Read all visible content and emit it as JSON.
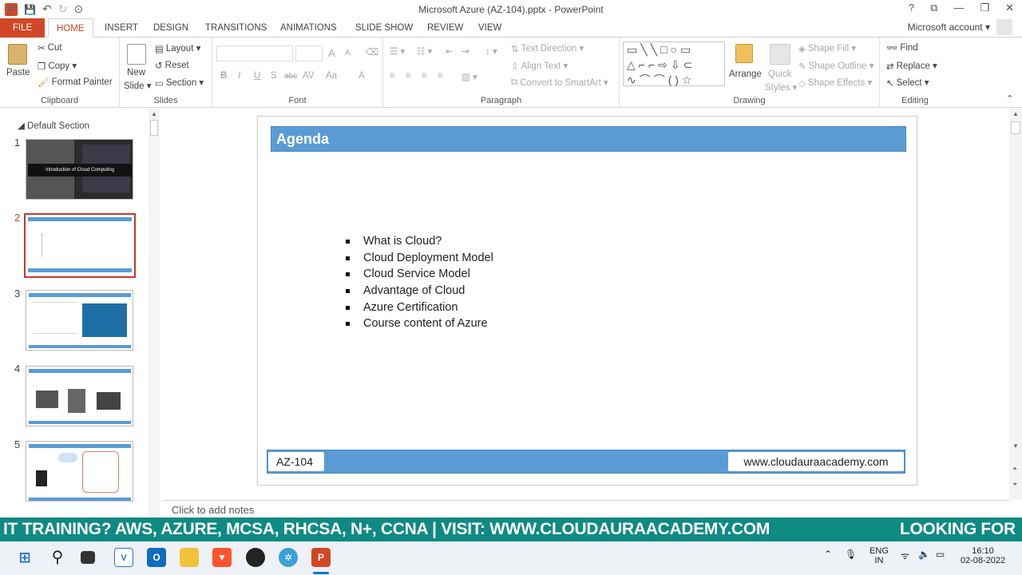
{
  "window": {
    "title": "Microsoft Azure (AZ-104).pptx - PowerPoint",
    "help": "?",
    "ribbon_display": "⧉",
    "minimize": "—",
    "maximize": "❐",
    "close": "✕"
  },
  "qat": {
    "app_icon": "P",
    "save": "💾",
    "undo": "↶",
    "redo": "↻",
    "customize": "⊙"
  },
  "tabs": [
    "FILE",
    "HOME",
    "INSERT",
    "DESIGN",
    "TRANSITIONS",
    "ANIMATIONS",
    "SLIDE SHOW",
    "REVIEW",
    "VIEW"
  ],
  "account": "Microsoft account",
  "ribbon": {
    "clipboard": {
      "label": "Clipboard",
      "paste": "Paste",
      "cut": "Cut",
      "copy": "Copy",
      "format_painter": "Format Painter"
    },
    "slides": {
      "label": "Slides",
      "new_slide": "New",
      "new_slide2": "Slide",
      "layout": "Layout",
      "reset": "Reset",
      "section": "Section"
    },
    "font": {
      "label": "Font",
      "bold": "B",
      "italic": "I",
      "underline": "U",
      "shadow": "S",
      "strike": "abc",
      "spacing": "AV",
      "case": "Aa",
      "grow": "A",
      "shrink": "A",
      "color": "A"
    },
    "paragraph": {
      "label": "Paragraph",
      "text_direction": "Text Direction",
      "align_text": "Align Text",
      "convert_smartart": "Convert to SmartArt"
    },
    "drawing": {
      "label": "Drawing",
      "arrange": "Arrange",
      "quick_styles": "Quick",
      "quick_styles2": "Styles",
      "shape_fill": "Shape Fill",
      "shape_outline": "Shape Outline",
      "shape_effects": "Shape Effects"
    },
    "editing": {
      "label": "Editing",
      "find": "Find",
      "replace": "Replace",
      "select": "Select"
    }
  },
  "thumbnails": {
    "section": "Default Section",
    "numbers": [
      "1",
      "2",
      "3",
      "4",
      "5"
    ],
    "slide1_title": "Introduction of Cloud Computing"
  },
  "slide": {
    "title": "Agenda",
    "bullets": [
      "What is Cloud?",
      "Cloud Deployment Model",
      "Cloud Service Model",
      "Advantage of Cloud",
      "Azure Certification",
      "Course content of Azure"
    ],
    "footer_left": "AZ-104",
    "footer_right": "www.cloudauraacademy.com"
  },
  "notes_placeholder": "Click to add notes",
  "ticker": {
    "text1": "IT TRAINING? AWS, AZURE, MCSA, RHCSA, N+, CCNA | VISIT: WWW.CLOUDAURAACADEMY.COM",
    "text2": "LOOKING FOR"
  },
  "taskbar": {
    "lang1": "ENG",
    "lang2": "IN",
    "time": "16:10",
    "date": "02-08-2022"
  }
}
